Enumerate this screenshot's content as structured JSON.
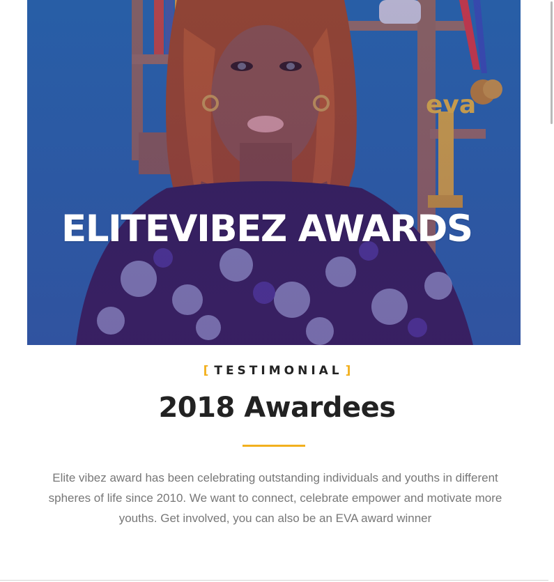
{
  "hero": {
    "image_alt": "Woman in lace dress in front of shelf with EVA award trophy",
    "trophy_lettering": "eva",
    "title": "ELITEVIBEZ AWARDS",
    "overlay_color": "#5a2a9c"
  },
  "section": {
    "eyebrow_open": "[",
    "eyebrow": "TESTIMONIAL",
    "eyebrow_close": "]",
    "title": "2018 Awardees",
    "description": "Elite vibez award has been celebrating outstanding individuals and youths in different spheres of life since 2010. We want to connect, celebrate empower and motivate more youths. Get involved, you can also be an EVA award winner"
  },
  "colors": {
    "accent": "#f2b01e",
    "heading": "#222222",
    "body_text": "#777777",
    "hero_blue": "#1f6fae"
  }
}
